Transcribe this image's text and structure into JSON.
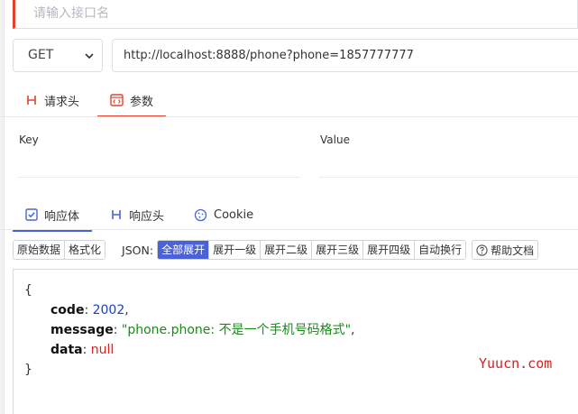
{
  "name_field": {
    "placeholder": "请输入接口名"
  },
  "request": {
    "method": "GET",
    "url": "http://localhost:8888/phone?phone=1857777777"
  },
  "request_tabs": [
    {
      "label": "请求头",
      "icon": "h-icon",
      "active": false
    },
    {
      "label": "参数",
      "icon": "code-doc-icon",
      "active": true
    }
  ],
  "params_table": {
    "key_header": "Key",
    "value_header": "Value"
  },
  "response_tabs": [
    {
      "label": "响应体",
      "icon": "checkbox-icon",
      "active": true
    },
    {
      "label": "响应头",
      "icon": "h-icon",
      "active": false
    },
    {
      "label": "Cookie",
      "icon": "cookie-icon",
      "active": false
    }
  ],
  "format_buttons": {
    "raw": "原始数据",
    "format": "格式化"
  },
  "json_label": "JSON:",
  "expand_buttons": [
    "全部展开",
    "展开一级",
    "展开二级",
    "展开三级",
    "展开四级",
    "自动换行"
  ],
  "expand_selected": "全部展开",
  "help_label": "帮助文档",
  "response_body": {
    "open_brace": "{",
    "close_brace": "}",
    "fields": [
      {
        "key": "code",
        "value": "2002",
        "type": "number",
        "suffix": ","
      },
      {
        "key": "message",
        "value": "\"phone.phone: 不是一个手机号码格式\"",
        "type": "string",
        "suffix": ","
      },
      {
        "key": "data",
        "value": "null",
        "type": "null",
        "suffix": ""
      }
    ]
  },
  "watermark": "Yuucn.com",
  "colors": {
    "accent_red": "#e0442f",
    "accent_blue": "#4b62d6",
    "string_green": "#178c17",
    "number_blue": "#1a3fcc",
    "null_red": "#d12424"
  }
}
